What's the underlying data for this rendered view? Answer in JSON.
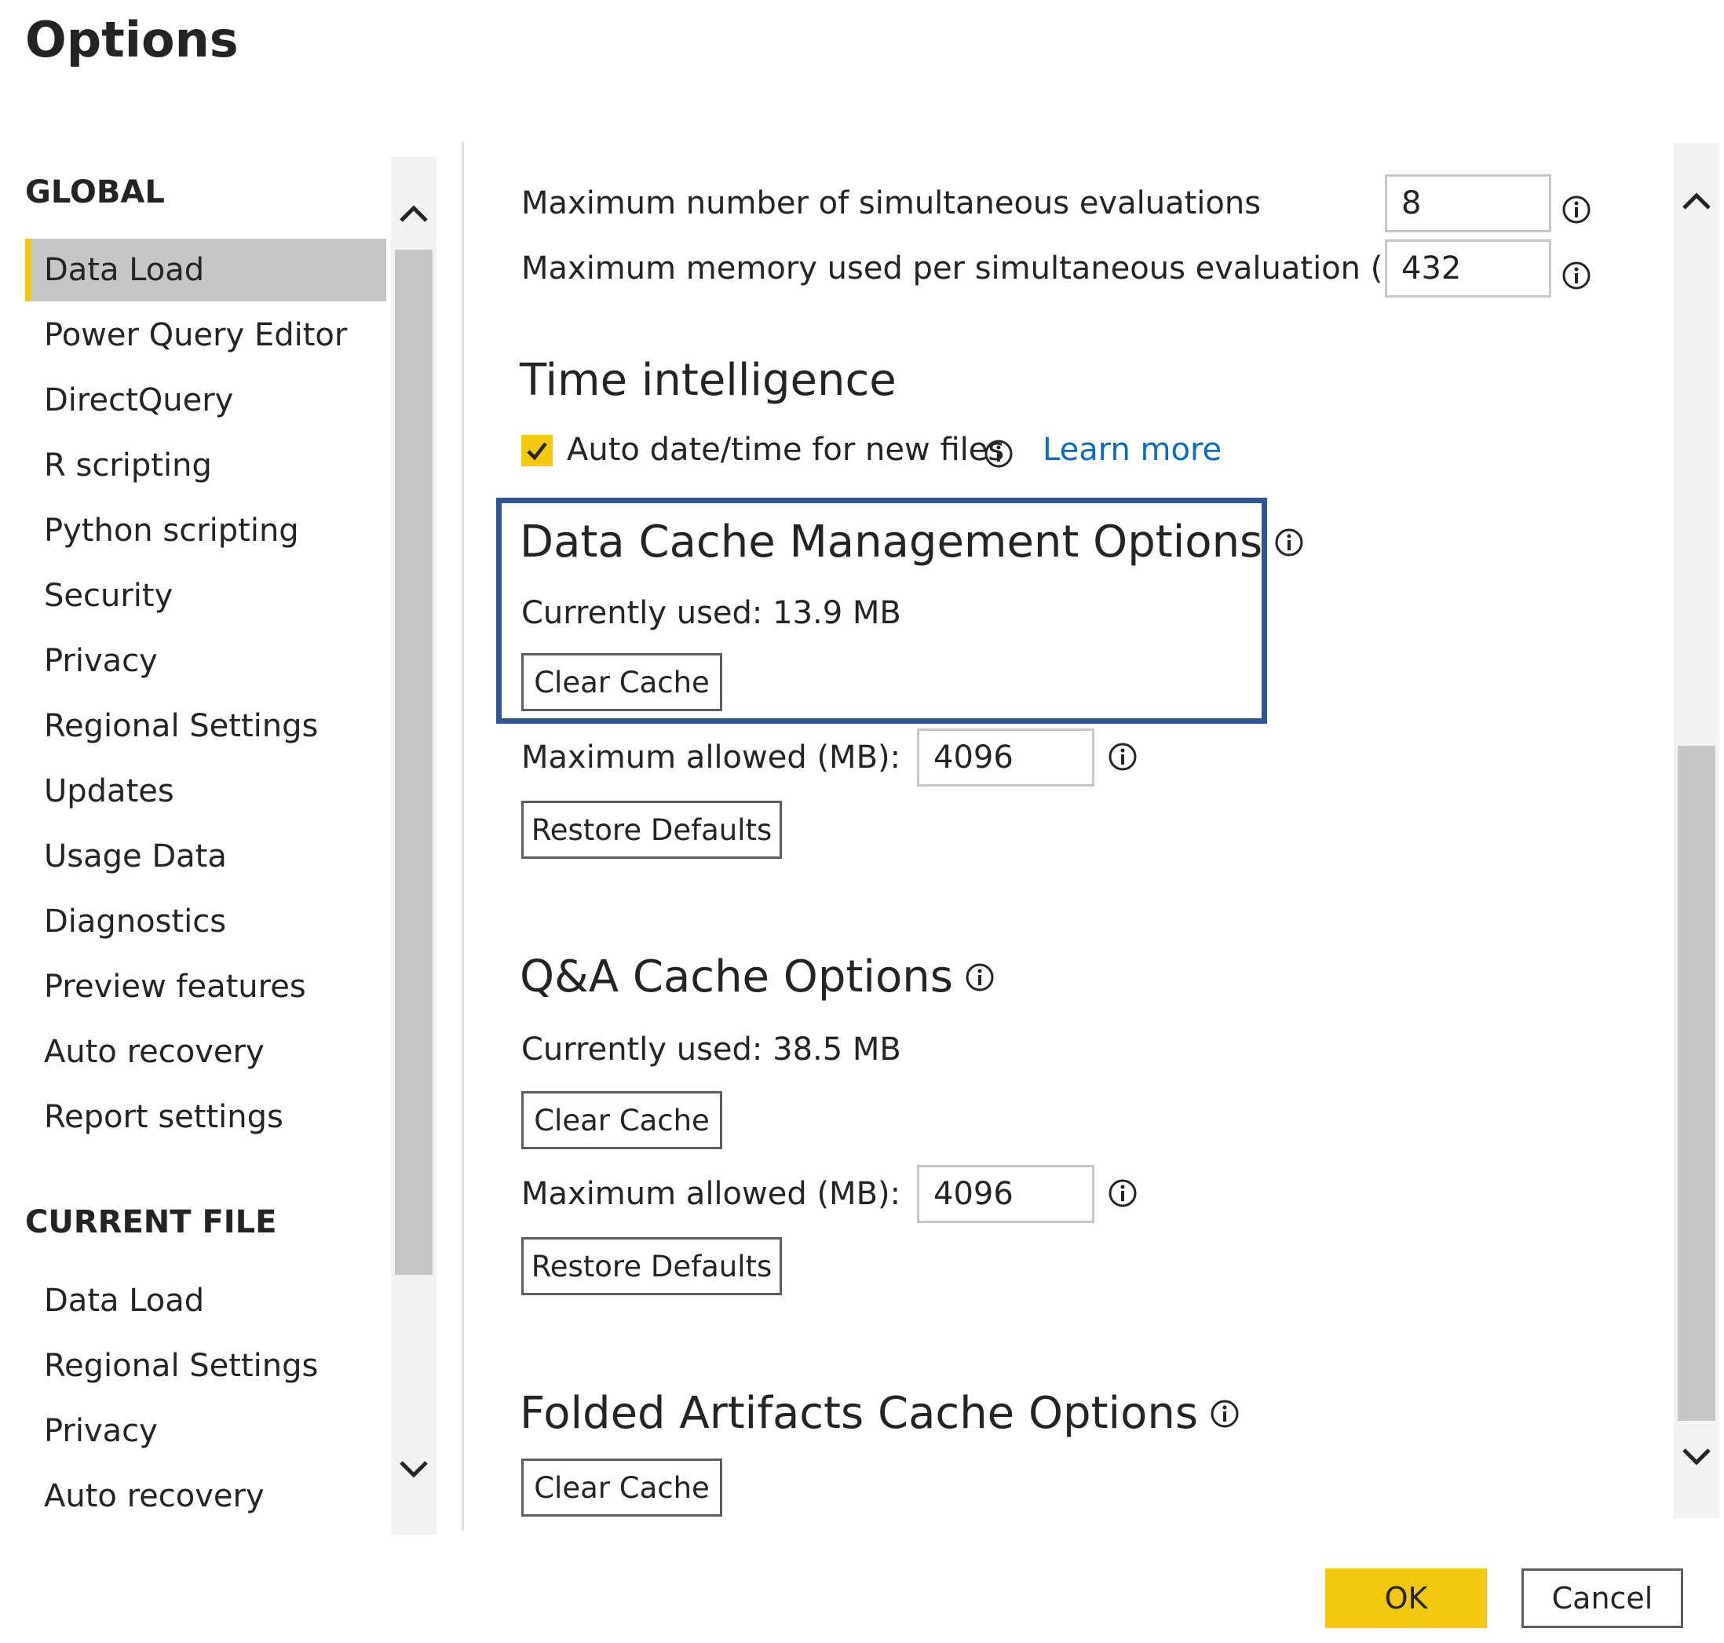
{
  "dialog": {
    "title": "Options"
  },
  "sidebar": {
    "global_heading": "GLOBAL",
    "global_items": [
      {
        "label": "Data Load",
        "selected": true
      },
      {
        "label": "Power Query Editor"
      },
      {
        "label": "DirectQuery"
      },
      {
        "label": "R scripting"
      },
      {
        "label": "Python scripting"
      },
      {
        "label": "Security"
      },
      {
        "label": "Privacy"
      },
      {
        "label": "Regional Settings"
      },
      {
        "label": "Updates"
      },
      {
        "label": "Usage Data"
      },
      {
        "label": "Diagnostics"
      },
      {
        "label": "Preview features"
      },
      {
        "label": "Auto recovery"
      },
      {
        "label": "Report settings"
      }
    ],
    "current_file_heading": "CURRENT FILE",
    "current_file_items": [
      {
        "label": "Data Load"
      },
      {
        "label": "Regional Settings"
      },
      {
        "label": "Privacy"
      },
      {
        "label": "Auto recovery"
      }
    ]
  },
  "content": {
    "max_simultaneous_evaluations": {
      "label": "Maximum number of simultaneous evaluations",
      "value": "8"
    },
    "max_memory_per_evaluation": {
      "label": "Maximum memory used per simultaneous evaluation (MB)",
      "value": "432"
    },
    "time_intelligence": {
      "heading": "Time intelligence",
      "auto_datetime_label": "Auto date/time for new files",
      "auto_datetime_checked": true,
      "learn_more": "Learn more"
    },
    "data_cache": {
      "heading": "Data Cache Management Options",
      "currently_used": "Currently used: 13.9 MB",
      "clear_cache": "Clear Cache",
      "max_allowed_label": "Maximum allowed (MB):",
      "max_allowed_value": "4096",
      "restore_defaults": "Restore Defaults"
    },
    "qa_cache": {
      "heading": "Q&A Cache Options",
      "currently_used": "Currently used: 38.5 MB",
      "clear_cache": "Clear Cache",
      "max_allowed_label": "Maximum allowed (MB):",
      "max_allowed_value": "4096",
      "restore_defaults": "Restore Defaults"
    },
    "folded_artifacts_cache": {
      "heading": "Folded Artifacts Cache Options",
      "clear_cache": "Clear Cache"
    }
  },
  "footer": {
    "ok": "OK",
    "cancel": "Cancel"
  },
  "colors": {
    "accent_yellow": "#f2c811",
    "link_blue": "#0f6cbd",
    "highlight_border": "#2f5597",
    "selected_bg": "#c8c6c4"
  },
  "icons": [
    "info-icon",
    "chevron-up-icon",
    "chevron-down-icon",
    "checkmark-icon"
  ]
}
